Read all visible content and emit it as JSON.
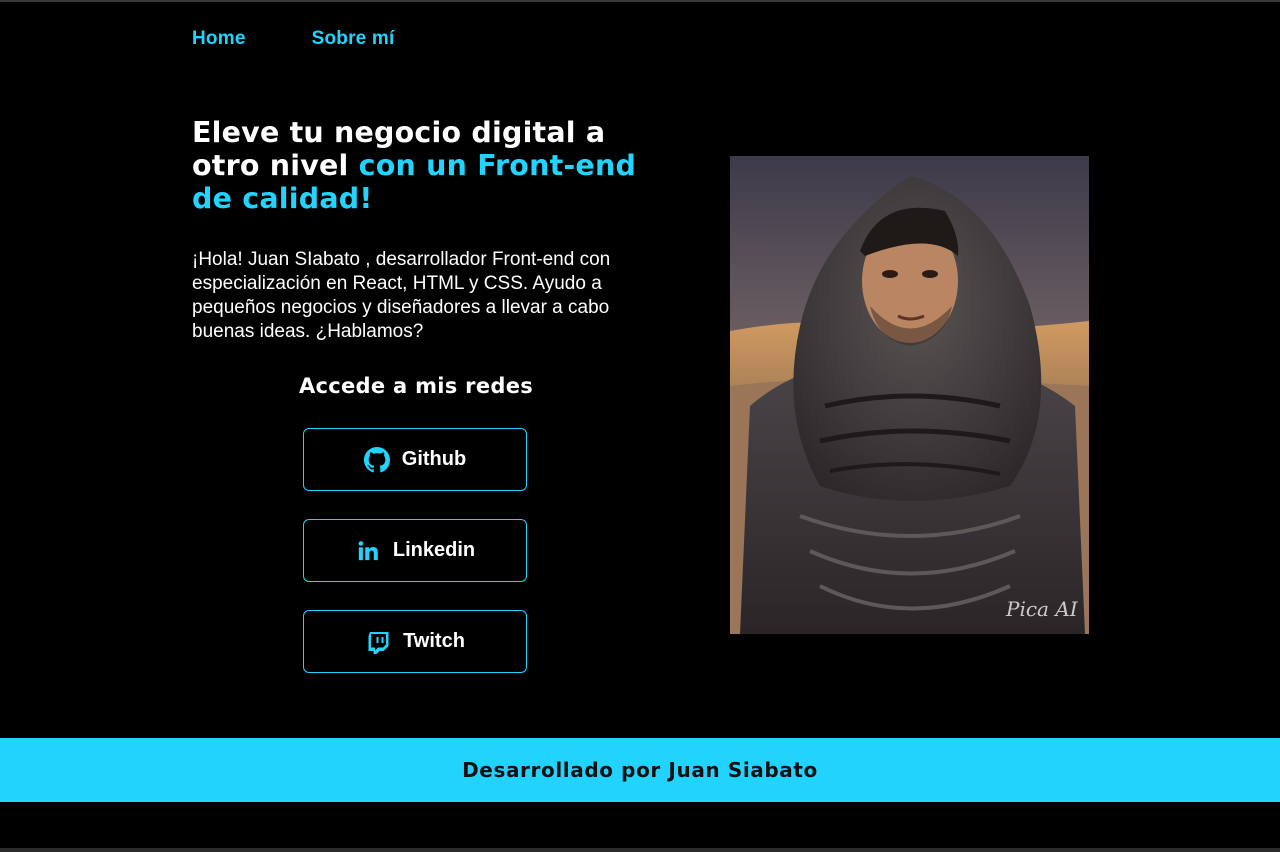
{
  "nav": {
    "home": "Home",
    "about": "Sobre mí"
  },
  "hero": {
    "headline_plain": "Eleve tu negocio digital a otro nivel ",
    "headline_accent": "con un Front-end de calidad!",
    "intro": "¡Hola! Juan SIabato , desarrollador Front-end con especialización en React, HTML y CSS. Ayudo a pequeños negocios y diseñadores a llevar a cabo buenas ideas. ¿Hablamos?"
  },
  "social": {
    "title": "Accede a mis redes",
    "buttons": [
      {
        "label": "Github",
        "icon": "github-icon"
      },
      {
        "label": "Linkedin",
        "icon": "linkedin-icon"
      },
      {
        "label": "Twitch",
        "icon": "twitch-icon"
      }
    ]
  },
  "portrait": {
    "watermark": "Pica AI"
  },
  "footer": {
    "text": "Desarrollado por Juan Siabato"
  },
  "colors": {
    "accent": "#22d4fd",
    "background": "#000000",
    "text": "#ffffff"
  }
}
